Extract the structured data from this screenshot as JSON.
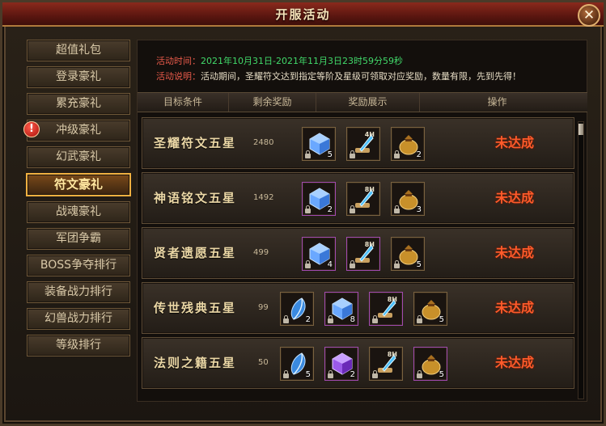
{
  "window": {
    "title": "开服活动"
  },
  "sidebar": {
    "items": [
      {
        "label": "超值礼包"
      },
      {
        "label": "登录豪礼"
      },
      {
        "label": "累充豪礼"
      },
      {
        "label": "冲级豪礼",
        "alert": "!"
      },
      {
        "label": "幻武豪礼"
      },
      {
        "label": "符文豪礼",
        "active": true
      },
      {
        "label": "战魂豪礼"
      },
      {
        "label": "军团争霸"
      },
      {
        "label": "BOSS争夺排行"
      },
      {
        "label": "装备战力排行"
      },
      {
        "label": "幻兽战力排行"
      },
      {
        "label": "等级排行"
      }
    ]
  },
  "info": {
    "time_label": "活动时间：",
    "time_value": "2021年10月31日-2021年11月3日23时59分59秒",
    "desc_label": "活动说明：",
    "desc_value": "活动期间，圣耀符文达到指定等阶及星级可领取对应奖励，数量有限，先到先得！"
  },
  "table": {
    "headers": [
      "目标条件",
      "剩余奖励",
      "奖励展示",
      "操作"
    ],
    "rows": [
      {
        "name": "圣耀符文五星",
        "count": "2480",
        "status": "未达成",
        "items": [
          {
            "icon": "blue-crystal-icon",
            "qty": "5"
          },
          {
            "icon": "feather-scroll-icon",
            "tag": "4H"
          },
          {
            "icon": "gold-sack-icon",
            "qty": "2"
          }
        ]
      },
      {
        "name": "神语铭文五星",
        "count": "1492",
        "status": "未达成",
        "items": [
          {
            "icon": "blue-crystal-icon",
            "qty": "2",
            "rarity": "purple"
          },
          {
            "icon": "feather-scroll-icon",
            "tag": "8H"
          },
          {
            "icon": "gold-sack-icon",
            "qty": "3"
          }
        ]
      },
      {
        "name": "贤者遗愿五星",
        "count": "499",
        "status": "未达成",
        "items": [
          {
            "icon": "blue-crystal-icon",
            "qty": "4",
            "rarity": "purple"
          },
          {
            "icon": "feather-scroll-icon",
            "tag": "8H",
            "rarity": "purple"
          },
          {
            "icon": "gold-sack-icon",
            "qty": "5"
          }
        ]
      },
      {
        "name": "传世残典五星",
        "count": "99",
        "status": "未达成",
        "items": [
          {
            "icon": "blue-gem-icon",
            "qty": "2"
          },
          {
            "icon": "blue-crystal-icon",
            "qty": "8",
            "rarity": "purple"
          },
          {
            "icon": "feather-scroll-icon",
            "tag": "8H",
            "rarity": "purple"
          },
          {
            "icon": "gold-sack-icon",
            "qty": "5"
          }
        ]
      },
      {
        "name": "法则之籍五星",
        "count": "50",
        "status": "未达成",
        "items": [
          {
            "icon": "blue-gem-icon",
            "qty": "5"
          },
          {
            "icon": "purple-crystal-icon",
            "qty": "2",
            "rarity": "purple"
          },
          {
            "icon": "feather-scroll-icon",
            "tag": "8H"
          },
          {
            "icon": "gold-sack-icon",
            "qty": "5",
            "rarity": "purple"
          }
        ]
      }
    ]
  },
  "colors": {
    "accent_gold": "#f0b040",
    "status_red": "#ff5a2a",
    "time_green": "#41d96a",
    "label_red": "#e85a4a"
  },
  "icons": {
    "close": "close-icon",
    "alert": "alert-icon"
  }
}
